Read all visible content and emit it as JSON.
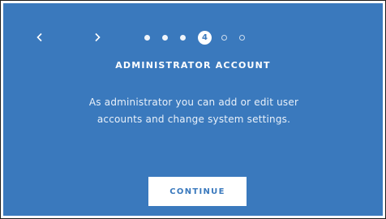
{
  "nav": {
    "back_icon": "chevron-left-icon",
    "forward_icon": "chevron-right-icon"
  },
  "progress": {
    "total_steps": 6,
    "current_step": 4,
    "current_label": "4"
  },
  "content": {
    "title": "ADMINISTRATOR ACCOUNT",
    "description_line1": "As administrator you can add or edit user",
    "description_line2": "accounts and change system settings."
  },
  "actions": {
    "continue_label": "CONTINUE"
  },
  "colors": {
    "background": "#3a79bd",
    "button_bg": "#ffffff",
    "button_text": "#3a79bd",
    "text": "#ffffff"
  }
}
